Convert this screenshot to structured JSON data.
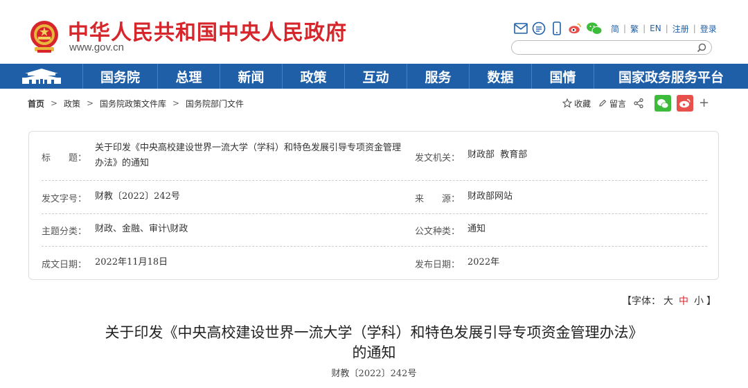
{
  "header": {
    "site_title": "中华人民共和国中央人民政府",
    "site_url": "www.gov.cn",
    "languages": [
      "简",
      "繁",
      "EN",
      "注册",
      "登录"
    ],
    "lang_separator": "|",
    "search": {
      "placeholder": "",
      "value": ""
    }
  },
  "nav": {
    "items": [
      "国务院",
      "总理",
      "新闻",
      "政策",
      "互动",
      "服务",
      "数据",
      "国情",
      "国家政务服务平台"
    ]
  },
  "breadcrumb": {
    "items": [
      "首页",
      "政策",
      "国务院政策文件库",
      "国务院部门文件"
    ],
    "separator": ">"
  },
  "share": {
    "favorite_label": "收藏",
    "comment_label": "留言",
    "plus": "+"
  },
  "info": {
    "title_label": "标　　题：",
    "title_value": "关于印发《中央高校建设世界一流大学（学科）和特色发展引导专项资金管理办法》的通知",
    "issuer_label": "发文机关：",
    "issuer_value": "财政部  教育部",
    "doc_no_label": "发文字号：",
    "doc_no_value": "财教〔2022〕242号",
    "source_label": "来　　源：",
    "source_value": "财政部网站",
    "category_label": "主题分类：",
    "category_value": "财政、金融、审计\\财政",
    "type_label": "公文种类：",
    "type_value": "通知",
    "created_label": "成文日期：",
    "created_value": "2022年11月18日",
    "published_label": "发布日期：",
    "published_value": "2022年"
  },
  "font_switch": {
    "prefix": "【字体：",
    "large": "大",
    "medium": "中",
    "small": "小",
    "suffix": "】"
  },
  "article": {
    "title_line1": "关于印发《中央高校建设世界一流大学（学科）和特色发展引导专项资金管理办法》",
    "title_line2": "的通知",
    "doc_no": "财教〔2022〕242号"
  },
  "colors": {
    "brand_red": "#d6262b",
    "nav_blue": "#1f5fa8",
    "wechat_green": "#3dbb3a",
    "weibo_red": "#e8504b"
  },
  "icons": [
    "national-emblem-icon",
    "mail-icon",
    "message-icon",
    "mobile-icon",
    "weibo-icon",
    "wechat-icon",
    "search-icon",
    "tiananmen-icon",
    "star-icon",
    "pen-icon",
    "share-icon"
  ]
}
